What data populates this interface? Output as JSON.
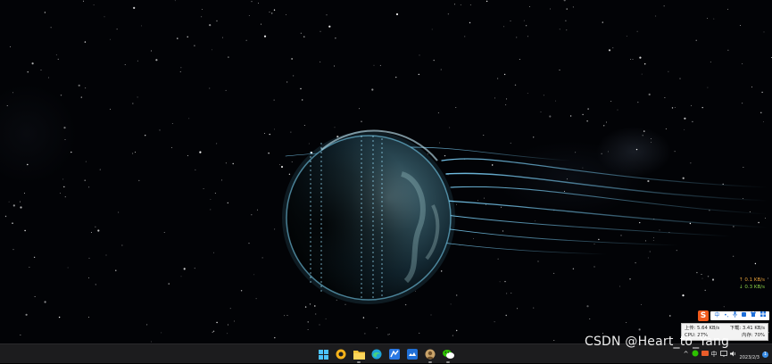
{
  "desktop": {
    "wallpaper": "Earth planet in starfield with blue solar wind streaks"
  },
  "netmon": {
    "upload": "↑ 0.1 KB/s",
    "download": "↓ 0.3 KB/s",
    "upload_color": "#e8a23a",
    "download_color": "#8bd14a"
  },
  "ime": {
    "logo": "S",
    "items": [
      "中",
      "•,",
      "🎤",
      "▤",
      "👕",
      "⋮⋮"
    ]
  },
  "traffic": {
    "upload": "上传: 5.64 KB/s",
    "download": "下载: 3.41 KB/s",
    "cpu": "CPU: 27%",
    "mem": "内存: 70%"
  },
  "taskbar": {
    "apps": [
      "windows-start",
      "photos",
      "file-explorer",
      "edge",
      "app-blue",
      "app-blue-2",
      "app-avatar",
      "wechat"
    ],
    "tray": {
      "chevron": "^",
      "ime_indicator": "中",
      "clock_time": "",
      "clock_date": "2023/2/3",
      "notifications": "1"
    }
  },
  "watermark": "CSDN @Heart_to_Yang"
}
